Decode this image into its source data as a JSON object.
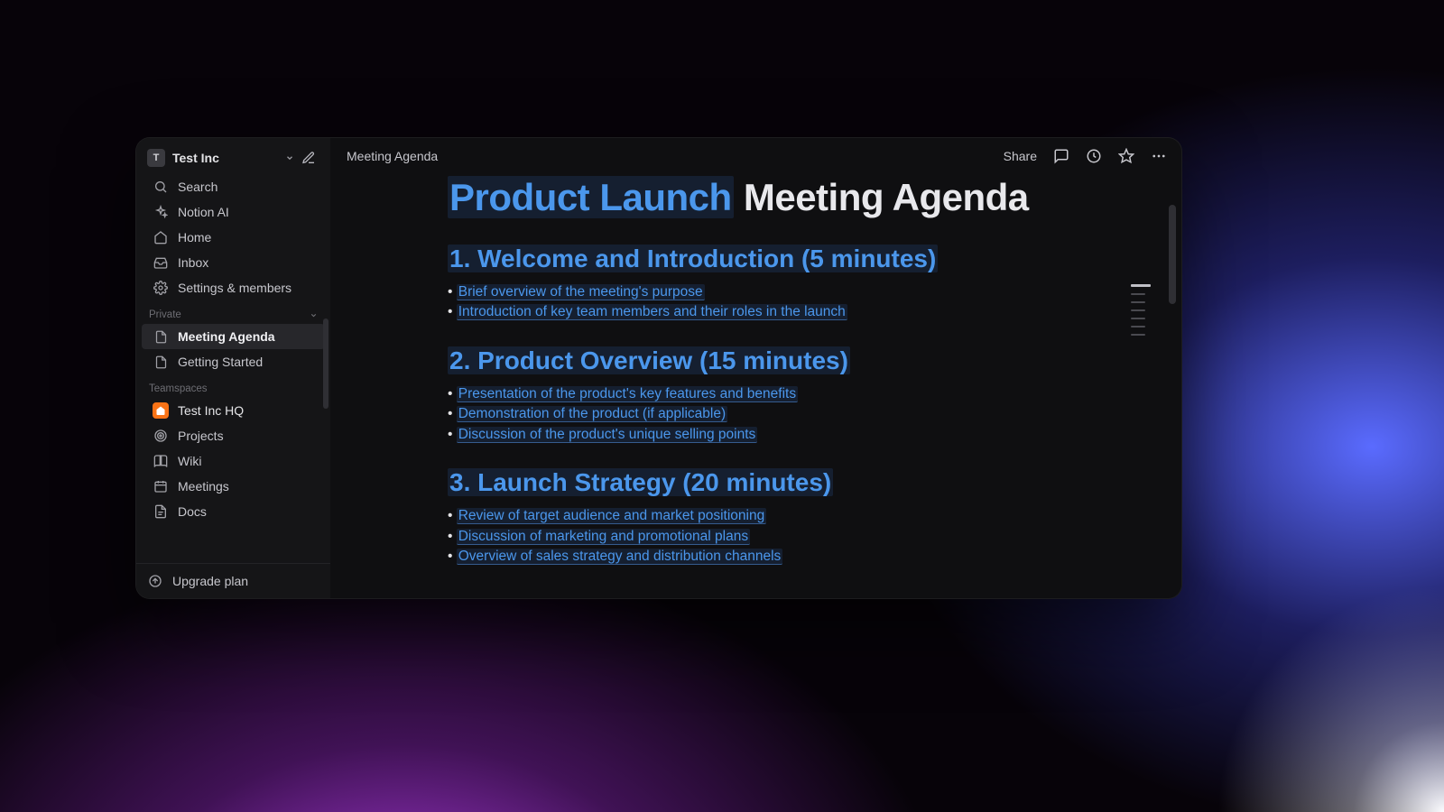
{
  "workspace": {
    "avatar_initial": "T",
    "name": "Test Inc"
  },
  "sidebar": {
    "search": "Search",
    "ai": "Notion AI",
    "home": "Home",
    "inbox": "Inbox",
    "settings": "Settings & members",
    "private_label": "Private",
    "pages": [
      {
        "label": "Meeting Agenda",
        "active": true
      },
      {
        "label": "Getting Started",
        "active": false
      }
    ],
    "teamspaces_label": "Teamspaces",
    "teamspaces": [
      {
        "label": "Test Inc HQ",
        "icon": "home"
      },
      {
        "label": "Projects",
        "icon": "target"
      },
      {
        "label": "Wiki",
        "icon": "book"
      },
      {
        "label": "Meetings",
        "icon": "calendar"
      },
      {
        "label": "Docs",
        "icon": "doc"
      }
    ],
    "upgrade": "Upgrade plan"
  },
  "topbar": {
    "breadcrumb": "Meeting Agenda",
    "share": "Share"
  },
  "document": {
    "title_highlight": "Product Launch",
    "title_rest": " Meeting Agenda",
    "sections": [
      {
        "heading": "1. Welcome and Introduction (5 minutes)",
        "bullets": [
          "Brief overview of the meeting's purpose",
          "Introduction of key team members and their roles in the launch"
        ]
      },
      {
        "heading": "2. Product Overview (15 minutes)",
        "bullets": [
          "Presentation of the product's key features and benefits",
          "Demonstration of the product (if applicable)",
          "Discussion of the product's unique selling points"
        ]
      },
      {
        "heading": "3. Launch Strategy (20 minutes)",
        "bullets": [
          "Review of target audience and market positioning",
          "Discussion of marketing and promotional plans",
          "Overview of sales strategy and distribution channels"
        ]
      }
    ]
  }
}
